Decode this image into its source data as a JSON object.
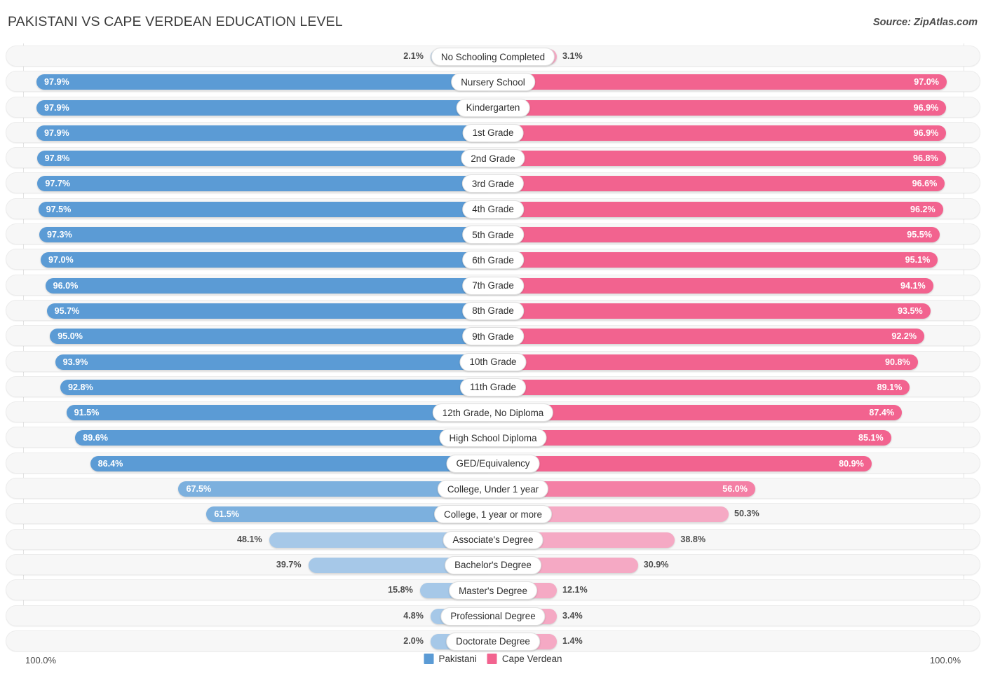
{
  "header": {
    "title": "PAKISTANI VS CAPE VERDEAN EDUCATION LEVEL",
    "source": "Source: ZipAtlas.com"
  },
  "footer": {
    "axis_left": "100.0%",
    "axis_right": "100.0%",
    "legend": [
      {
        "label": "Pakistani",
        "color": "#5b9bd5"
      },
      {
        "label": "Cape Verdean",
        "color": "#f2638f"
      }
    ]
  },
  "colors": {
    "blue_strong": "#5b9bd5",
    "blue_mid": "#7cb0de",
    "blue_light": "#a6c8e8",
    "pink_strong": "#f2638f",
    "pink_mid": "#f47fa5",
    "pink_light": "#f5a9c4",
    "row_bg": "#f7f7f7",
    "text_dark": "#4c4c4c"
  },
  "chart_data": {
    "type": "bar",
    "orientation": "horizontal-diverging",
    "title": "PAKISTANI VS CAPE VERDEAN EDUCATION LEVEL",
    "xlabel": "",
    "ylabel": "",
    "xlim": [
      0,
      100
    ],
    "grid": true,
    "legend_position": "bottom-center",
    "axis_tick_labels": [
      "100.0%",
      "100.0%"
    ],
    "categories": [
      "No Schooling Completed",
      "Nursery School",
      "Kindergarten",
      "1st Grade",
      "2nd Grade",
      "3rd Grade",
      "4th Grade",
      "5th Grade",
      "6th Grade",
      "7th Grade",
      "8th Grade",
      "9th Grade",
      "10th Grade",
      "11th Grade",
      "12th Grade, No Diploma",
      "High School Diploma",
      "GED/Equivalency",
      "College, Under 1 year",
      "College, 1 year or more",
      "Associate's Degree",
      "Bachelor's Degree",
      "Master's Degree",
      "Professional Degree",
      "Doctorate Degree"
    ],
    "series": [
      {
        "name": "Pakistani",
        "color": "#5b9bd5",
        "values": [
          2.1,
          97.9,
          97.9,
          97.9,
          97.8,
          97.7,
          97.5,
          97.3,
          97.0,
          96.0,
          95.7,
          95.0,
          93.9,
          92.8,
          91.5,
          89.6,
          86.4,
          67.5,
          61.5,
          48.1,
          39.7,
          15.8,
          4.8,
          2.0
        ],
        "labels": [
          "2.1%",
          "97.9%",
          "97.9%",
          "97.9%",
          "97.8%",
          "97.7%",
          "97.5%",
          "97.3%",
          "97.0%",
          "96.0%",
          "95.7%",
          "95.0%",
          "93.9%",
          "92.8%",
          "91.5%",
          "89.6%",
          "86.4%",
          "67.5%",
          "61.5%",
          "48.1%",
          "39.7%",
          "15.8%",
          "4.8%",
          "2.0%"
        ]
      },
      {
        "name": "Cape Verdean",
        "color": "#f2638f",
        "values": [
          3.1,
          97.0,
          96.9,
          96.9,
          96.8,
          96.6,
          96.2,
          95.5,
          95.1,
          94.1,
          93.5,
          92.2,
          90.8,
          89.1,
          87.4,
          85.1,
          80.9,
          56.0,
          50.3,
          38.8,
          30.9,
          12.1,
          3.4,
          1.4
        ],
        "labels": [
          "3.1%",
          "97.0%",
          "96.9%",
          "96.9%",
          "96.8%",
          "96.6%",
          "96.2%",
          "95.5%",
          "95.1%",
          "94.1%",
          "93.5%",
          "92.2%",
          "90.8%",
          "89.1%",
          "87.4%",
          "85.1%",
          "80.9%",
          "56.0%",
          "50.3%",
          "38.8%",
          "30.9%",
          "12.1%",
          "3.4%",
          "1.4%"
        ]
      }
    ]
  }
}
